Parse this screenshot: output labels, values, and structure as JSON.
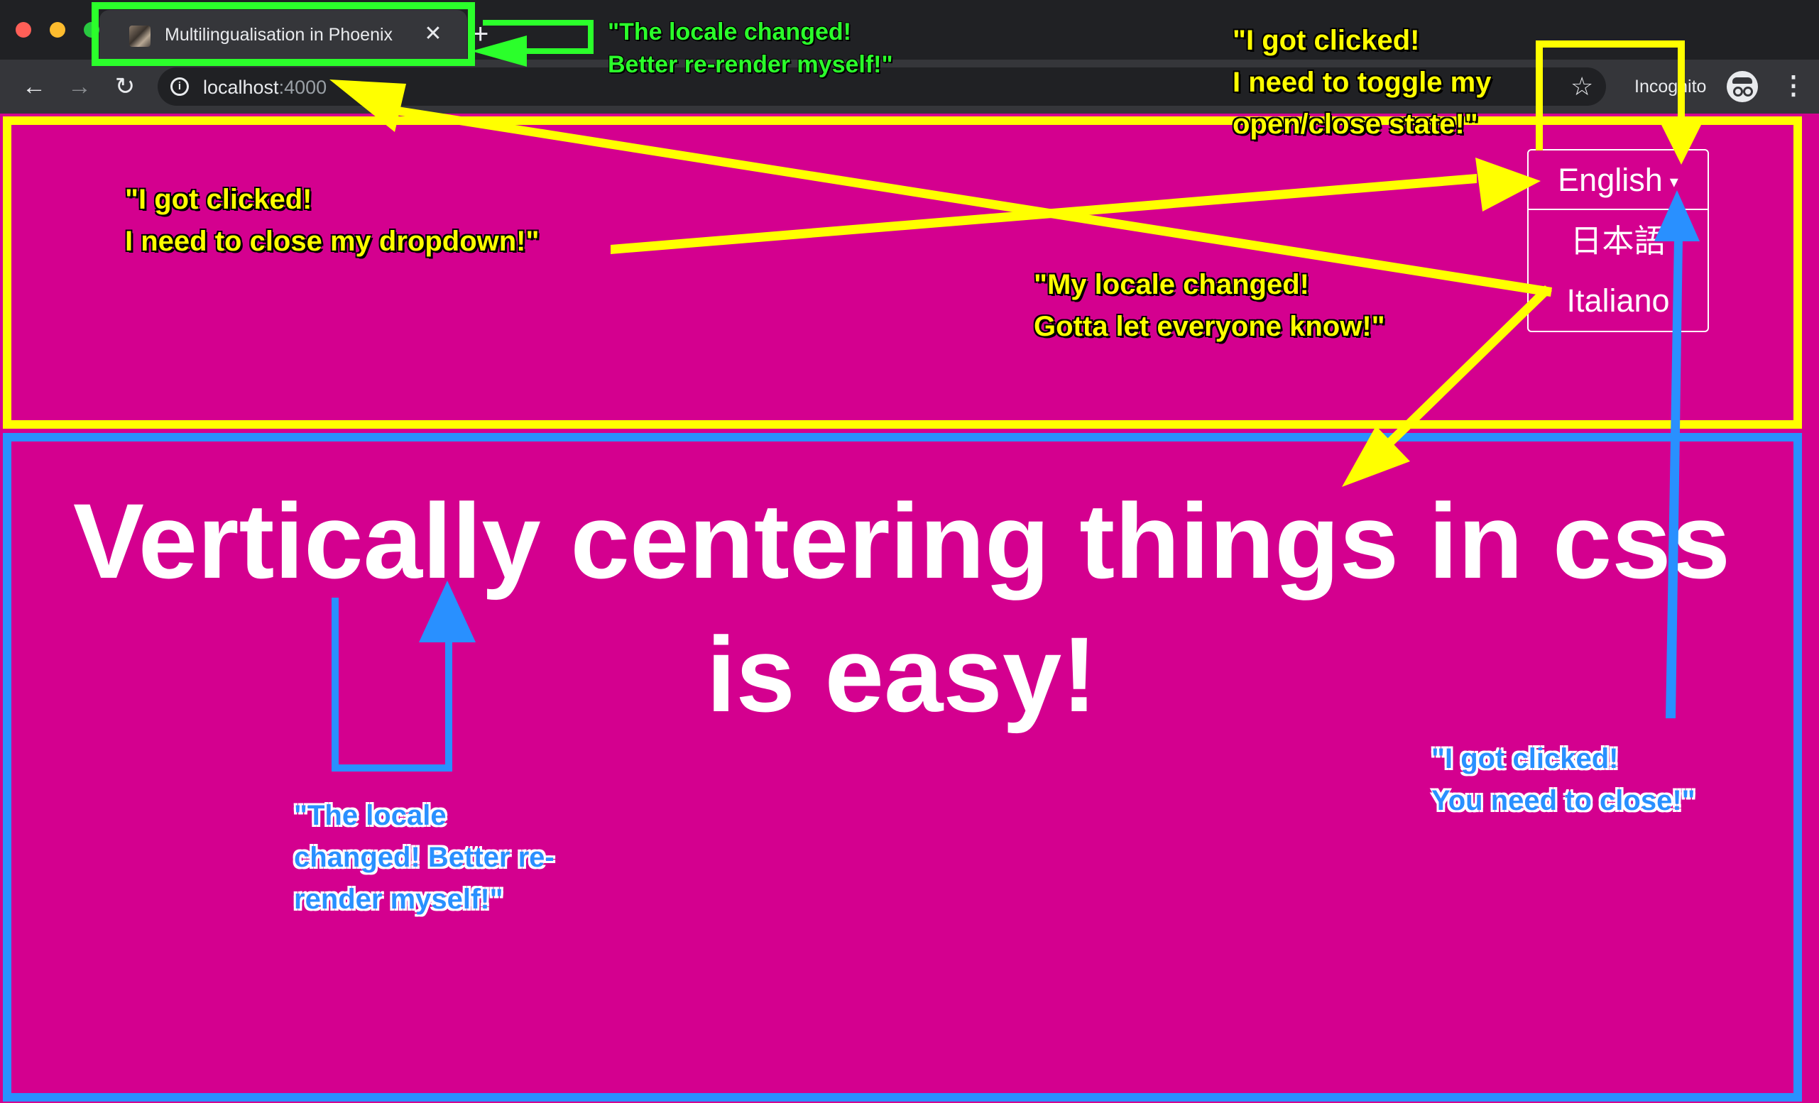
{
  "browser": {
    "tab_title": "Multilingualisation in Phoenix",
    "tab_close": "✕",
    "new_tab": "+",
    "back": "←",
    "forward": "→",
    "reload": "↻",
    "url_host": "localhost",
    "url_port": ":4000",
    "bookmark": "☆",
    "incognito_label": "Incognito",
    "menu": "⋮"
  },
  "page": {
    "dropdown": {
      "selected": "English",
      "caret": "▾",
      "options": [
        "日本語",
        "Italiano"
      ]
    },
    "headline": "Vertically centering things in css is easy!"
  },
  "annotations": {
    "tab_note": "\"The locale changed!\nBetter re-render myself!\"",
    "toggle_note": "\"I got clicked!\nI need to toggle my\nopen/close state!\"",
    "close_dropdown_note": "\"I got clicked!\nI need to close my dropdown!\"",
    "locale_changed_note": "\"My locale changed!\nGotta let everyone know!\"",
    "rerender_note": "\"The locale\nchanged! Better re-\nrender myself!\"",
    "you_close_note": "\"I got clicked!\nYou need to close!\""
  },
  "colors": {
    "page_bg": "#d4008f",
    "header_outline": "#ffff00",
    "content_outline": "#2990ff",
    "tab_outline": "#2bff2b"
  }
}
